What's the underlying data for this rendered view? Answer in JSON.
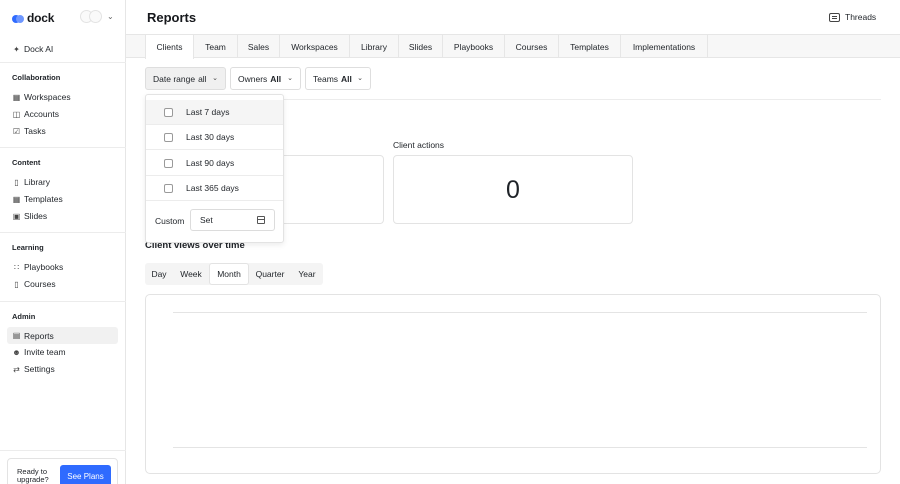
{
  "app": {
    "brand": "dock"
  },
  "sidebar": {
    "ai_item": "Dock AI",
    "sections": [
      {
        "heading": "Collaboration",
        "items": [
          "Workspaces",
          "Accounts",
          "Tasks"
        ]
      },
      {
        "heading": "Content",
        "items": [
          "Library",
          "Templates",
          "Slides"
        ]
      },
      {
        "heading": "Learning",
        "items": [
          "Playbooks",
          "Courses"
        ]
      },
      {
        "heading": "Admin",
        "items": [
          "Reports",
          "Invite team",
          "Settings"
        ]
      }
    ],
    "active_item": "Reports",
    "upgrade_text": "Ready to upgrade?",
    "upgrade_button": "See Plans"
  },
  "header": {
    "title": "Reports",
    "threads_label": "Threads"
  },
  "tabs": [
    "Clients",
    "Team",
    "Sales",
    "Workspaces",
    "Library",
    "Slides",
    "Playbooks",
    "Courses",
    "Templates",
    "Implementations"
  ],
  "active_tab": "Clients",
  "filters": {
    "date_range": {
      "label": "Date range",
      "value": "all"
    },
    "owners": {
      "label": "Owners",
      "value": "All"
    },
    "teams": {
      "label": "Teams",
      "value": "All"
    }
  },
  "date_dropdown": {
    "options": [
      "Last 7 days",
      "Last 30 days",
      "Last 90 days",
      "Last 365 days"
    ],
    "highlighted": "Last 7 days",
    "custom_label": "Custom",
    "custom_placeholder": "Set"
  },
  "stats": [
    {
      "label": "Client actions",
      "value": "0"
    }
  ],
  "client_views_section": {
    "title": "Client views over time",
    "periods": [
      "Day",
      "Week",
      "Month",
      "Quarter",
      "Year"
    ],
    "active_period": "Month"
  },
  "colors": {
    "accent": "#2f6bff",
    "border": "#e3e3e3",
    "tab_bg": "#f7f7f7"
  },
  "icons": {
    "ai": "sparkle-icon",
    "workspaces": "grid-icon",
    "accounts": "building-icon",
    "tasks": "checklist-icon",
    "library": "library-icon",
    "templates": "template-icon",
    "slides": "slides-icon",
    "playbooks": "playbook-icon",
    "courses": "book-icon",
    "reports": "bar-chart-icon",
    "invite": "user-plus-icon",
    "settings": "sliders-icon",
    "threads": "chat-icon",
    "calendar": "calendar-icon"
  }
}
